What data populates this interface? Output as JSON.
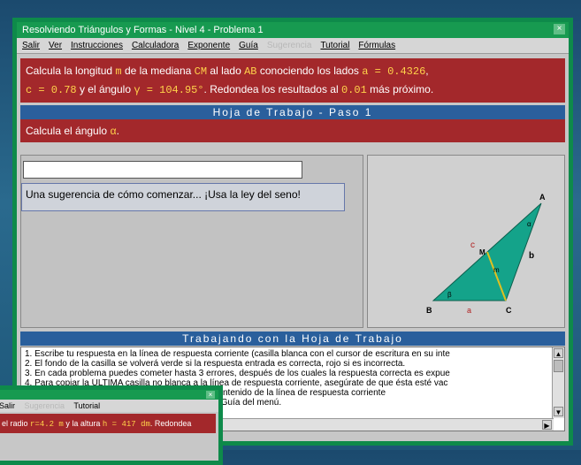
{
  "window": {
    "title": "Resolviendo Triángulos y Formas  -  Nivel  4  -  Problema  1",
    "close_glyph": "×"
  },
  "menu": {
    "items": [
      {
        "label": "Salir",
        "disabled": false
      },
      {
        "label": "Ver",
        "disabled": false
      },
      {
        "label": "Instrucciones",
        "disabled": false
      },
      {
        "label": "Calculadora",
        "disabled": false
      },
      {
        "label": "Exponente",
        "disabled": false
      },
      {
        "label": "Guía",
        "disabled": false
      },
      {
        "label": "Sugerencia",
        "disabled": true
      },
      {
        "label": "Tutorial",
        "disabled": false
      },
      {
        "label": "Fórmulas",
        "disabled": false
      }
    ]
  },
  "problem": {
    "t1": "Calcula la longitud ",
    "m": "m",
    "t2": " de la mediana ",
    "cm": "CM",
    "t3": " al lado ",
    "ab": "AB",
    "t4": " conociendo los lados ",
    "a_eq": "a = 0.4326",
    "t5": ",",
    "c_eq": "c = 0.78",
    "t6": " y el ángulo ",
    "g_eq": "γ = 104.95°",
    "t7": ". Redondea los resultados al ",
    "round": "0.01",
    "t8": " más próximo."
  },
  "worksheet": {
    "title": "Hoja de Trabajo  -   Paso  1",
    "step_text": "Calcula el ángulo ",
    "step_var": "α",
    "step_end": "."
  },
  "answer": {
    "value": ""
  },
  "hint": "Una sugerencia de cómo comenzar... ¡Usa la ley del seno!",
  "diagram": {
    "labels": {
      "A": "A",
      "B": "B",
      "C": "C",
      "M": "M",
      "a": "a",
      "b": "b",
      "c": "c",
      "m": "m",
      "alpha": "α",
      "beta": "β"
    }
  },
  "working": {
    "title": "Trabajando con la Hoja de Trabajo",
    "lines": [
      "1. Escribe tu respuesta en la línea de respuesta corriente (casilla blanca con el cursor de escritura en su inte",
      "2. El fondo de la casilla se volverá verde si la respuesta entrada es correcta, rojo si es incorrecta.",
      "3. En cada problema puedes cometer hasta 3 errores, después de los cuales la respuesta correcta es expue",
      "4. Para copiar la ÚLTIMA casilla no blanca a la línea de respuesta corriente, asegúrate de que ésta esté vac",
      "5. Para copiar CUALQUIER casilla no blanca al contenido de la línea de respuesta corriente",
      "6. Si no sabes resolver el problema, pulsa el ítem Guía del menú."
    ]
  },
  "colors": {
    "frame": "#0e8a4a",
    "problem_bg": "#a3282b",
    "bar_blue": "#2a5f9c",
    "triangle": "#14a38a",
    "highlight": "#ffd24a"
  },
  "second_window": {
    "menu": [
      "Salir",
      "Sugerencia",
      "Tutorial"
    ],
    "problem": {
      "t1": "el radio ",
      "r": "r=4.2 m",
      "t2": " y la altura ",
      "h": "h = 417 dm",
      "t3": ". Redondea"
    }
  }
}
